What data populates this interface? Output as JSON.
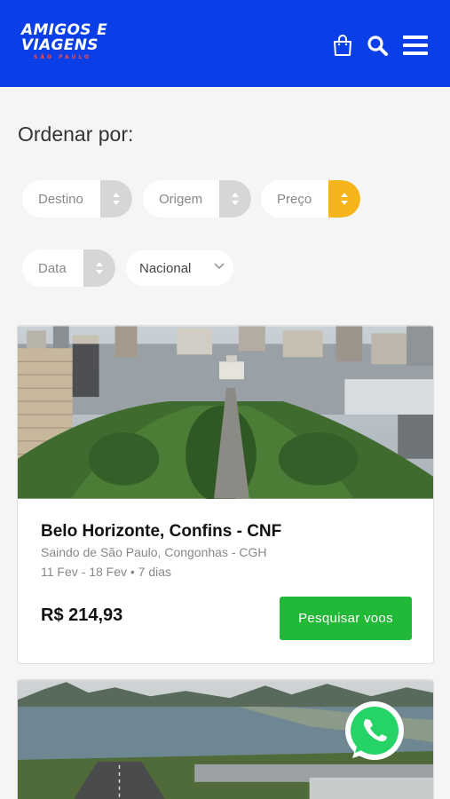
{
  "header": {
    "logo_line1": "AMIGOS E",
    "logo_line2": "VIAGENS",
    "logo_sub": "SÃO PAULO",
    "icons": [
      "shopping-bag-icon",
      "search-icon",
      "menu-icon"
    ],
    "bg_color": "#0a3fe8"
  },
  "sort": {
    "title": "Ordenar por:",
    "options": [
      {
        "label": "Destino",
        "active": false
      },
      {
        "label": "Origem",
        "active": false
      },
      {
        "label": "Preço",
        "active": true
      },
      {
        "label": "Data",
        "active": false
      }
    ],
    "scope_select": "Nacional",
    "active_color": "#f5b419"
  },
  "results": [
    {
      "destination": "Belo Horizonte, Confins - CNF",
      "origin": "Saindo de São Paulo, Congonhas - CGH",
      "dates": "11 Fev - 18 Fev • 7 dias",
      "price": "R$ 214,93",
      "button_label": "Pesquisar voos"
    }
  ],
  "colors": {
    "button": "#22b838",
    "whatsapp": "#25d366"
  }
}
